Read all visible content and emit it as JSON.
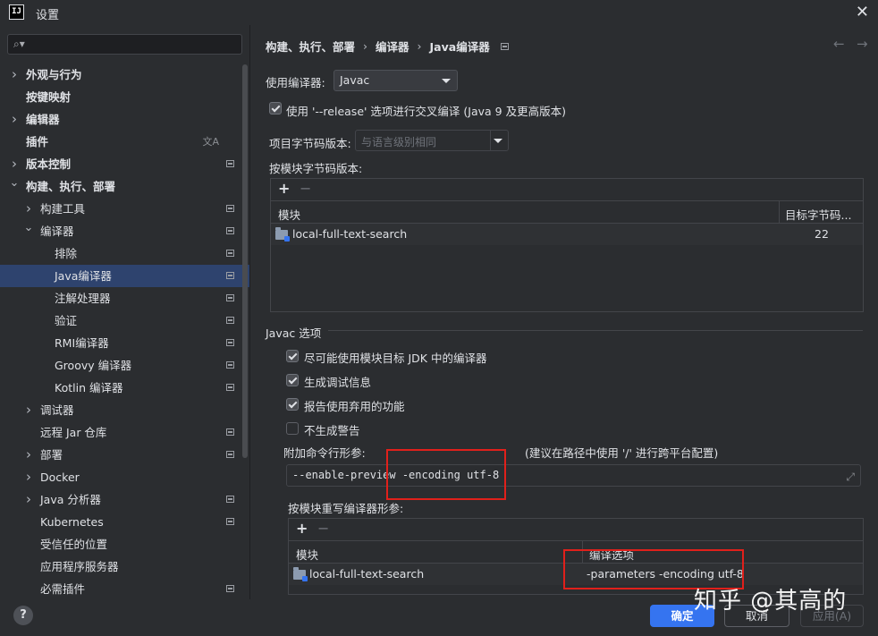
{
  "window": {
    "title": "设置",
    "logo": "IJ"
  },
  "sidebar": {
    "search_placeholder": "",
    "items": [
      {
        "label": "外观与行为",
        "level": 0,
        "arrow": "collapsed",
        "bold": true,
        "badge": false
      },
      {
        "label": "按键映射",
        "level": 0,
        "arrow": "none",
        "bold": true,
        "badge": false
      },
      {
        "label": "编辑器",
        "level": 0,
        "arrow": "collapsed",
        "bold": true,
        "badge": false
      },
      {
        "label": "插件",
        "level": 0,
        "arrow": "none",
        "bold": true,
        "badge": false,
        "translate": true
      },
      {
        "label": "版本控制",
        "level": 0,
        "arrow": "collapsed",
        "bold": true,
        "badge": true
      },
      {
        "label": "构建、执行、部署",
        "level": 0,
        "arrow": "expanded",
        "bold": true,
        "badge": false
      },
      {
        "label": "构建工具",
        "level": 1,
        "arrow": "collapsed",
        "bold": false,
        "badge": true
      },
      {
        "label": "编译器",
        "level": 1,
        "arrow": "expanded",
        "bold": false,
        "badge": true
      },
      {
        "label": "排除",
        "level": 2,
        "arrow": "none",
        "bold": false,
        "badge": true
      },
      {
        "label": "Java编译器",
        "level": 2,
        "arrow": "none",
        "bold": false,
        "badge": true,
        "selected": true
      },
      {
        "label": "注解处理器",
        "level": 2,
        "arrow": "none",
        "bold": false,
        "badge": true
      },
      {
        "label": "验证",
        "level": 2,
        "arrow": "none",
        "bold": false,
        "badge": true
      },
      {
        "label": "RMI编译器",
        "level": 2,
        "arrow": "none",
        "bold": false,
        "badge": true
      },
      {
        "label": "Groovy 编译器",
        "level": 2,
        "arrow": "none",
        "bold": false,
        "badge": true
      },
      {
        "label": "Kotlin 编译器",
        "level": 2,
        "arrow": "none",
        "bold": false,
        "badge": true
      },
      {
        "label": "调试器",
        "level": 1,
        "arrow": "collapsed",
        "bold": false,
        "badge": false
      },
      {
        "label": "远程 Jar 仓库",
        "level": 1,
        "arrow": "none",
        "bold": false,
        "badge": true
      },
      {
        "label": "部署",
        "level": 1,
        "arrow": "collapsed",
        "bold": false,
        "badge": true
      },
      {
        "label": "Docker",
        "level": 1,
        "arrow": "collapsed",
        "bold": false,
        "badge": false
      },
      {
        "label": "Java 分析器",
        "level": 1,
        "arrow": "collapsed",
        "bold": false,
        "badge": true
      },
      {
        "label": "Kubernetes",
        "level": 1,
        "arrow": "none",
        "bold": false,
        "badge": true
      },
      {
        "label": "受信任的位置",
        "level": 1,
        "arrow": "none",
        "bold": false,
        "badge": false
      },
      {
        "label": "应用程序服务器",
        "level": 1,
        "arrow": "none",
        "bold": false,
        "badge": false
      },
      {
        "label": "必需插件",
        "level": 1,
        "arrow": "none",
        "bold": false,
        "badge": true
      }
    ]
  },
  "breadcrumb": [
    "构建、执行、部署",
    "编译器",
    "Java编译器"
  ],
  "content": {
    "compiler_label": "使用编译器:",
    "compiler_value": "Javac",
    "release_checkbox": "使用 '--release' 选项进行交叉编译 (Java 9 及更高版本)",
    "project_bytecode_label": "项目字节码版本:",
    "project_bytecode_placeholder": "与语言级别相同",
    "per_module_label": "按模块字节码版本:",
    "module_table": {
      "columns": [
        "模块",
        "目标字节码..."
      ],
      "rows": [
        {
          "module": "local-full-text-search",
          "target": "22"
        }
      ]
    },
    "javac_section": "Javac 选项",
    "javac_options": [
      {
        "label": "尽可能使用模块目标 JDK 中的编译器",
        "checked": true
      },
      {
        "label": "生成调试信息",
        "checked": true
      },
      {
        "label": "报告使用弃用的功能",
        "checked": true
      },
      {
        "label": "不生成警告",
        "checked": false
      }
    ],
    "extra_params_label": "附加命令行形参:",
    "extra_params_hint": "(建议在路径中使用 '/' 进行跨平台配置)",
    "extra_params_value": "--enable-preview -encoding utf-8",
    "override_label": "按模块重写编译器形参:",
    "override_table": {
      "columns": [
        "模块",
        "编译选项"
      ],
      "rows": [
        {
          "module": "local-full-text-search",
          "options": "-parameters -encoding utf-8"
        }
      ]
    }
  },
  "footer": {
    "ok": "确定",
    "cancel": "取消",
    "apply": "应用(A)",
    "help": "?"
  },
  "watermark": "知乎 @其高的",
  "colors": {
    "accent": "#3574f0",
    "selection": "#2e436e",
    "highlight": "#e0201b",
    "background": "#2b2d30"
  },
  "icons": [
    "search-icon",
    "close-icon",
    "back-arrow-icon",
    "forward-arrow-icon",
    "folder-module-icon",
    "expand-icon",
    "help-icon",
    "translate-icon"
  ]
}
